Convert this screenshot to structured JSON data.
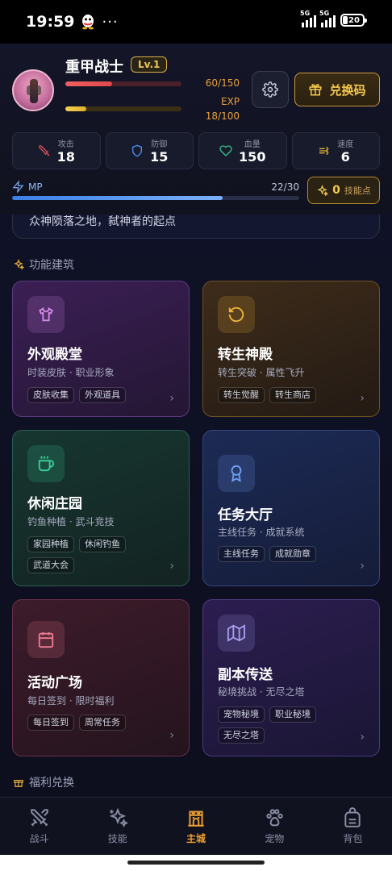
{
  "status": {
    "time": "19:59",
    "dots": "···",
    "sig1": "5G",
    "sig2": "5G",
    "battery": "20"
  },
  "player": {
    "name": "重甲战士",
    "level": "Lv.1",
    "hp_text": "60/150",
    "hp_fraction": 0.4,
    "exp_label": "EXP",
    "exp_text": "18/100",
    "exp_fraction": 0.18,
    "redeem_label": "兑换码"
  },
  "stats": [
    {
      "label": "攻击",
      "value": "18",
      "icon": "sword-icon",
      "color": "#e04f5f"
    },
    {
      "label": "防御",
      "value": "15",
      "icon": "shield-icon",
      "color": "#4f8ef0"
    },
    {
      "label": "血量",
      "value": "150",
      "icon": "heart-icon",
      "color": "#35c489"
    },
    {
      "label": "速度",
      "value": "6",
      "icon": "wind-icon",
      "color": "#e0b23a"
    }
  ],
  "mp": {
    "label": "MP",
    "text": "22/30",
    "fraction": 0.733
  },
  "skill_points": {
    "value": "0",
    "label": "技能点"
  },
  "banner_text": "众神陨落之地，弑神者的起点",
  "sections": {
    "buildings": "功能建筑",
    "welfare": "福利兑换"
  },
  "cards": [
    {
      "title": "外观殿堂",
      "subtitle": "时装皮肤 · 职业形象",
      "tags": [
        "皮肤收集",
        "外观道具"
      ],
      "icon": "shirt-icon",
      "accent": "#d58be8"
    },
    {
      "title": "转生神殿",
      "subtitle": "转生突破 · 属性飞升",
      "tags": [
        "转生觉醒",
        "转生商店"
      ],
      "icon": "rotate-icon",
      "accent": "#f0b43a"
    },
    {
      "title": "休闲庄园",
      "subtitle": "钓鱼种植 · 武斗竞技",
      "tags": [
        "家园种植",
        "休闲钓鱼",
        "武道大会"
      ],
      "icon": "cup-icon",
      "accent": "#38d39a"
    },
    {
      "title": "任务大厅",
      "subtitle": "主线任务 · 成就系统",
      "tags": [
        "主线任务",
        "成就勋章"
      ],
      "icon": "award-icon",
      "accent": "#6fa0f5"
    },
    {
      "title": "活动广场",
      "subtitle": "每日签到 · 限时福利",
      "tags": [
        "每日签到",
        "周常任务"
      ],
      "icon": "calendar-icon",
      "accent": "#f07b92"
    },
    {
      "title": "副本传送",
      "subtitle": "秘境挑战 · 无尽之塔",
      "tags": [
        "宠物秘境",
        "职业秘境",
        "无尽之塔"
      ],
      "icon": "map-icon",
      "accent": "#a8a0f0"
    }
  ],
  "nav": [
    {
      "label": "战斗",
      "icon": "swords-icon",
      "active": false
    },
    {
      "label": "技能",
      "icon": "sparkles-icon",
      "active": false
    },
    {
      "label": "主城",
      "icon": "castle-icon",
      "active": true
    },
    {
      "label": "宠物",
      "icon": "paw-icon",
      "active": false
    },
    {
      "label": "背包",
      "icon": "backpack-icon",
      "active": false
    }
  ]
}
